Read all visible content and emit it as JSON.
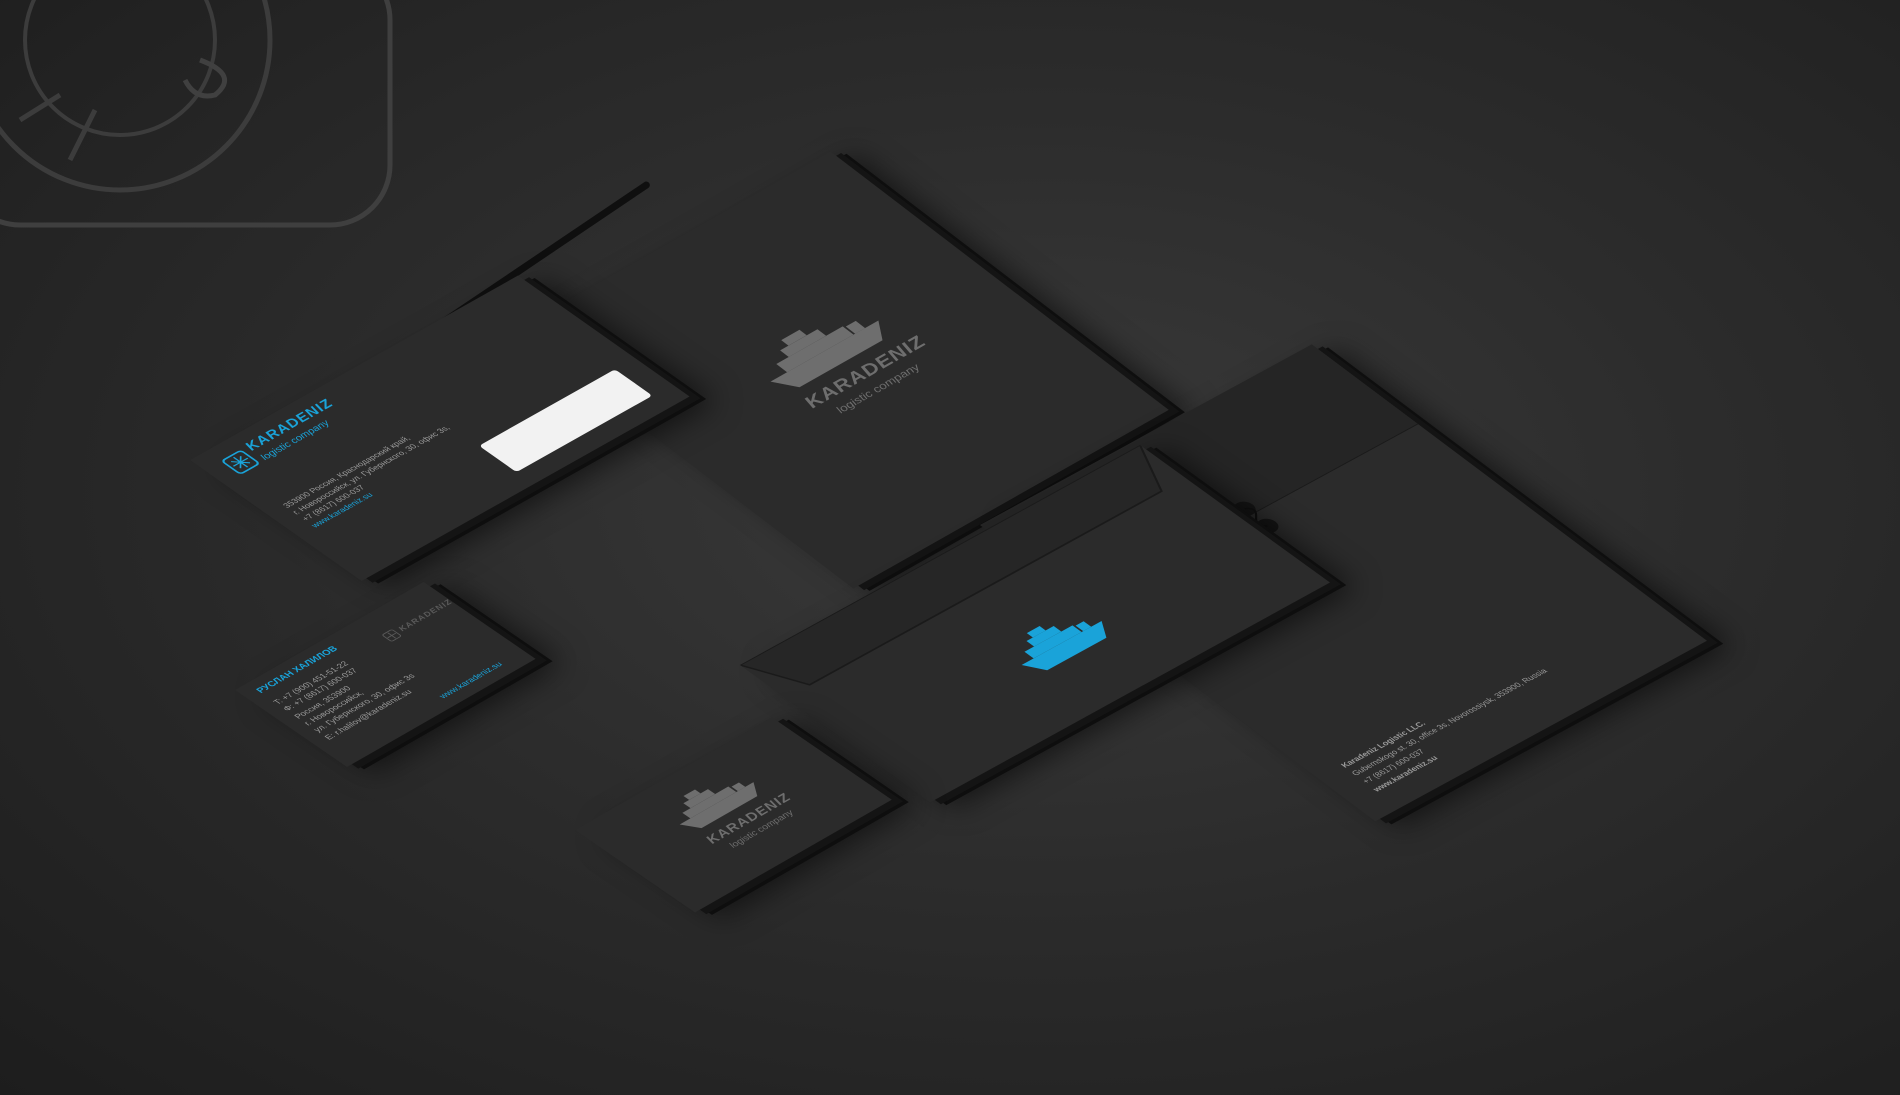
{
  "brand": {
    "name": "KARADENIZ",
    "tagline": "logistic company"
  },
  "colors": {
    "background": "#2c2c2c",
    "paper": "#2b2b2b",
    "logo_gray": "#6e6e6e",
    "accent_blue": "#1aa3d9",
    "window": "#f2f2f2"
  },
  "envelope_back": {
    "company": "Karadeniz Logistic LLC.",
    "address": "Gubernskogo st. 30, office 3s, Novorossiysk, 353900, Russia",
    "phone": "+7 (8617) 600-037",
    "website": "www.karadeniz.su"
  },
  "dl_envelope": {
    "address_lines": [
      "353900 Россия, Краснодарский край,",
      "г. Новороссийск, ул. Губернского, 30, офис 3s,",
      "+7 (8617) 600-037"
    ],
    "website": "www.karadeniz.su"
  },
  "business_card": {
    "person": "РУСЛАН ХАЛИЛОВ",
    "lines": [
      "T: +7 (900) 451-51-22",
      "Ф: +7 (8617) 600-037",
      "Россия, 353900",
      "г. Новороссийск,",
      "ул. Губернского, 30, офис 3s",
      "E: r.halilov@karadeniz.su"
    ],
    "website": "www.karadeniz.su"
  }
}
